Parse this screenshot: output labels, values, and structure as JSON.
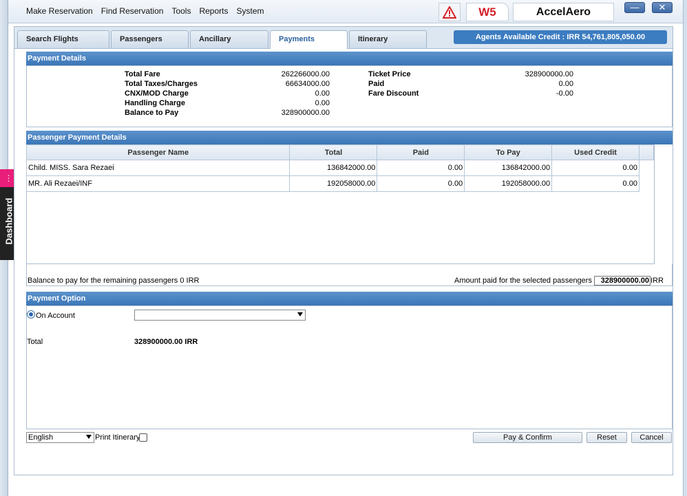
{
  "menu": [
    "Make Reservation",
    "Find Reservation",
    "Tools",
    "Reports",
    "System"
  ],
  "brand": {
    "code": "W5",
    "product": "AccelAero"
  },
  "window_controls": {
    "minimize": "—",
    "close": "✕"
  },
  "tabs": [
    {
      "label": "Search Flights",
      "active": false
    },
    {
      "label": "Passengers",
      "active": false
    },
    {
      "label": "Ancillary",
      "active": false
    },
    {
      "label": "Payments",
      "active": true
    },
    {
      "label": "Itinerary",
      "active": false
    }
  ],
  "agent_credit": "Agents Available Credit : IRR 54,761,805,050.00",
  "payment_details": {
    "title": "Payment Details",
    "left": [
      {
        "label": "Total Fare",
        "value": "262266000.00"
      },
      {
        "label": "Total Taxes/Charges",
        "value": "66634000.00"
      },
      {
        "label": "CNX/MOD Charge",
        "value": "0.00"
      },
      {
        "label": "Handling Charge",
        "value": "0.00"
      },
      {
        "label": "Balance to Pay",
        "value": "328900000.00"
      }
    ],
    "right": [
      {
        "label": "Ticket Price",
        "value": "328900000.00"
      },
      {
        "label": "Paid",
        "value": "0.00"
      },
      {
        "label": "Fare Discount",
        "value": "-0.00"
      }
    ]
  },
  "passenger_payment": {
    "title": "Passenger Payment Details",
    "columns": [
      "Passenger Name",
      "Total",
      "Paid",
      "To Pay",
      "Used Credit"
    ],
    "rows": [
      [
        "Child. MISS. Sara Rezaei",
        "136842000.00",
        "0.00",
        "136842000.00",
        "0.00"
      ],
      [
        "MR. Ali Rezaei/INF",
        "192058000.00",
        "0.00",
        "192058000.00",
        "0.00"
      ]
    ],
    "balance_remaining": "Balance to pay for the remaining passengers 0 IRR",
    "amount_paid_label": "Amount paid for the selected passengers :",
    "amount_paid_value": "328900000.00",
    "amount_currency": "IRR"
  },
  "payment_option": {
    "title": "Payment Option",
    "on_account_label": "On Account",
    "on_account_selected": true,
    "account_select_value": "",
    "total_label": "Total",
    "total_value": "328900000.00 IRR"
  },
  "footer": {
    "language": "English",
    "print_itinerary_label": "Print Itinerary",
    "print_itinerary_checked": false,
    "pay_confirm": "Pay & Confirm",
    "reset": "Reset",
    "cancel": "Cancel"
  },
  "dashboard_tab": {
    "label": "Dashboard",
    "icon": "dashboard-icon"
  },
  "colors": {
    "header_blue": "#3b76b7",
    "credit_blue": "#3c7cc0",
    "brand_red": "#d4202a",
    "dash_pink": "#e91e7a"
  }
}
